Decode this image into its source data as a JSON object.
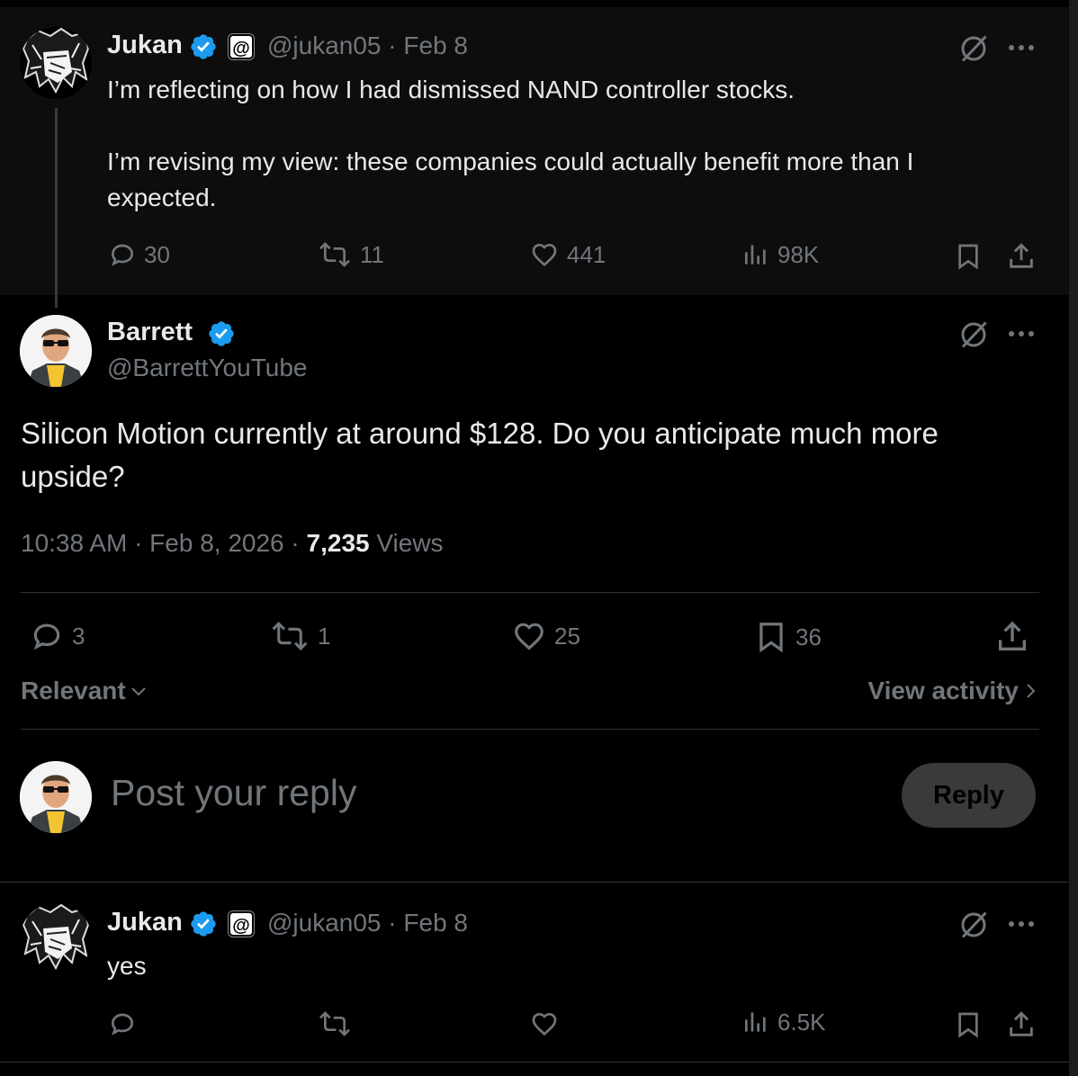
{
  "parent_tweet": {
    "author_name": "Jukan",
    "handle_date": "@jukan05 · Feb 8",
    "text_line1": "I’m reflecting on how I had dismissed NAND controller stocks.",
    "text_line2": "I’m revising my view: these companies could actually benefit more than I expected.",
    "replies": "30",
    "reposts": "11",
    "likes": "441",
    "views": "98K"
  },
  "main_tweet": {
    "author_name": "Barrett",
    "handle": "@BarrettYouTube",
    "text": "Silicon Motion currently at around $128. Do you anticipate much more upside?",
    "time_date": "10:38 AM · Feb 8, 2026 · ",
    "views_count": "7,235",
    "views_label": " Views",
    "replies": "3",
    "reposts": "1",
    "likes": "25",
    "bookmarks": "36"
  },
  "sort": {
    "label": "Relevant",
    "activity_label": "View activity"
  },
  "composer": {
    "placeholder": "Post your reply",
    "button_label": "Reply"
  },
  "reply_tweet": {
    "author_name": "Jukan",
    "handle_date": "@jukan05 · Feb 8",
    "text": "yes",
    "views": "6.5K"
  },
  "colors": {
    "background": "#000000",
    "text_primary": "#e7e9ea",
    "text_secondary": "#71767b",
    "verified_blue": "#1d9bf0",
    "divider": "#2f3336"
  },
  "icons": [
    "verified-badge-icon",
    "grok-icon",
    "more-icon",
    "reply-icon",
    "repost-icon",
    "like-icon",
    "views-icon",
    "bookmark-icon",
    "share-icon",
    "chevron-down-icon",
    "chevron-right-icon"
  ]
}
